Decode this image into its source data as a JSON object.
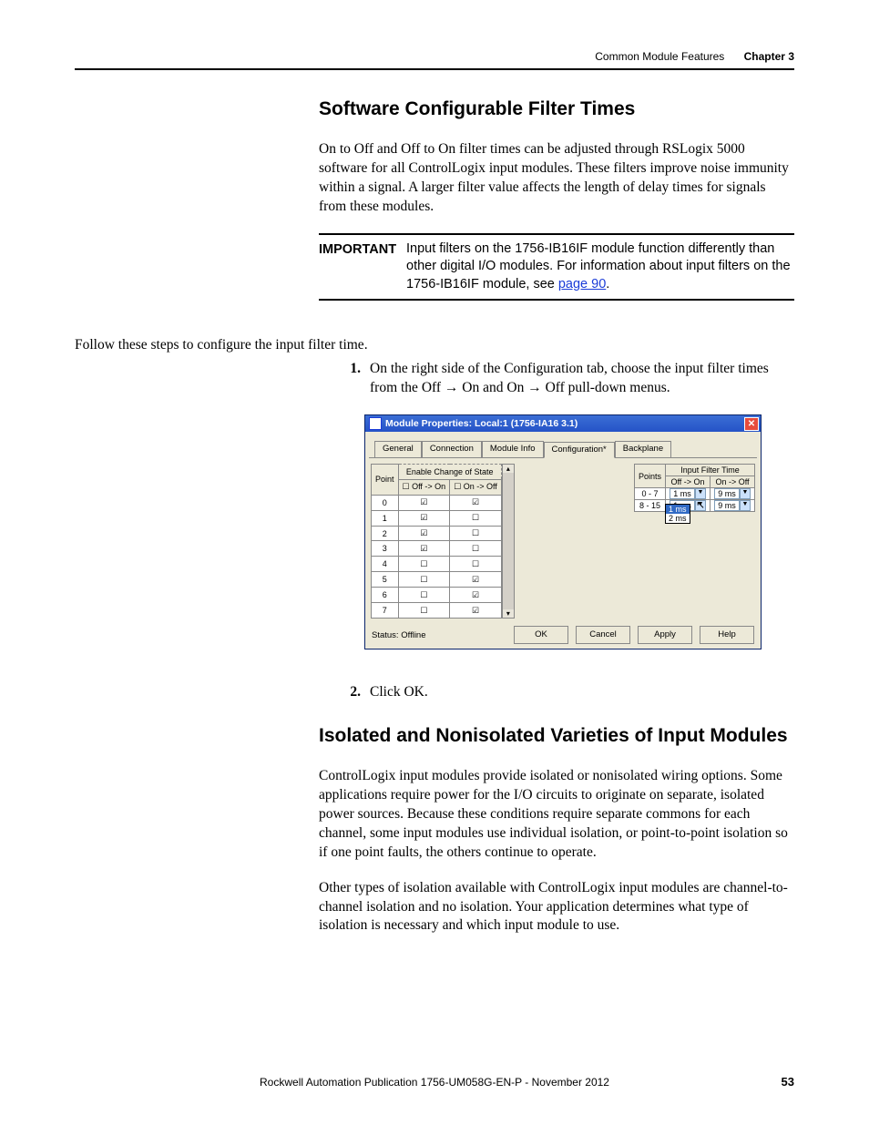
{
  "header": {
    "section": "Common Module Features",
    "chapter": "Chapter 3"
  },
  "heading1": "Software Configurable Filter Times",
  "para1": "On to Off and Off to On filter times can be adjusted through RSLogix 5000 software for all ControlLogix input modules. These filters improve noise immunity within a signal. A larger filter value affects the length of delay times for signals from these modules.",
  "important": {
    "label": "IMPORTANT",
    "text_before": "Input filters on the 1756-IB16IF module function differently than other digital I/O modules. For information about input filters on the 1756-IB16IF module, see ",
    "link": "page 90",
    "text_after": "."
  },
  "follow": "Follow these steps to configure the input filter time.",
  "step1": {
    "num": "1.",
    "text": "On the right side of the Configuration tab, choose the input filter times from the Off → On and On → Off pull-down menus."
  },
  "step2": {
    "num": "2.",
    "text": "Click OK."
  },
  "dialog": {
    "title": "Module Properties: Local:1 (1756-IA16 3.1)",
    "tabs": [
      "General",
      "Connection",
      "Module Info",
      "Configuration*",
      "Backplane"
    ],
    "cos_header_top": "Enable Change of State",
    "col_point": "Point",
    "col_off_on": "Off -> On",
    "col_on_off": "On -> Off",
    "points": [
      0,
      1,
      2,
      3,
      4,
      5,
      6,
      7
    ],
    "off_on_checks": [
      true,
      true,
      true,
      true,
      false,
      false,
      false,
      false
    ],
    "on_off_checks": [
      true,
      false,
      false,
      false,
      false,
      true,
      true,
      true
    ],
    "filter_header": "Input Filter Time",
    "filter_points_label": "Points",
    "filter_off_on": "Off -> On",
    "filter_on_off": "On -> Off",
    "filter_rows": [
      {
        "points": "0 - 7",
        "off_on": "1 ms",
        "on_off": "9 ms"
      },
      {
        "points": "8 - 15",
        "off_on": "1 ms",
        "on_off": "9 ms"
      }
    ],
    "dropdown_options": [
      "1 ms",
      "2 ms"
    ],
    "status": "Status: Offline",
    "buttons": [
      "OK",
      "Cancel",
      "Apply",
      "Help"
    ]
  },
  "heading2": "Isolated and Nonisolated Varieties of Input Modules",
  "para2": "ControlLogix input modules provide isolated or nonisolated wiring options. Some applications require power for the I/O circuits to originate on separate, isolated power sources. Because these conditions require separate commons for each channel, some input modules use individual isolation, or point-to-point isolation so if one point faults, the others continue to operate.",
  "para3": "Other types of isolation available with ControlLogix input modules are channel-to-channel isolation and no isolation. Your application determines what type of isolation is necessary and which input module to use.",
  "footer": "Rockwell Automation Publication 1756-UM058G-EN-P - November 2012",
  "page_num": "53"
}
